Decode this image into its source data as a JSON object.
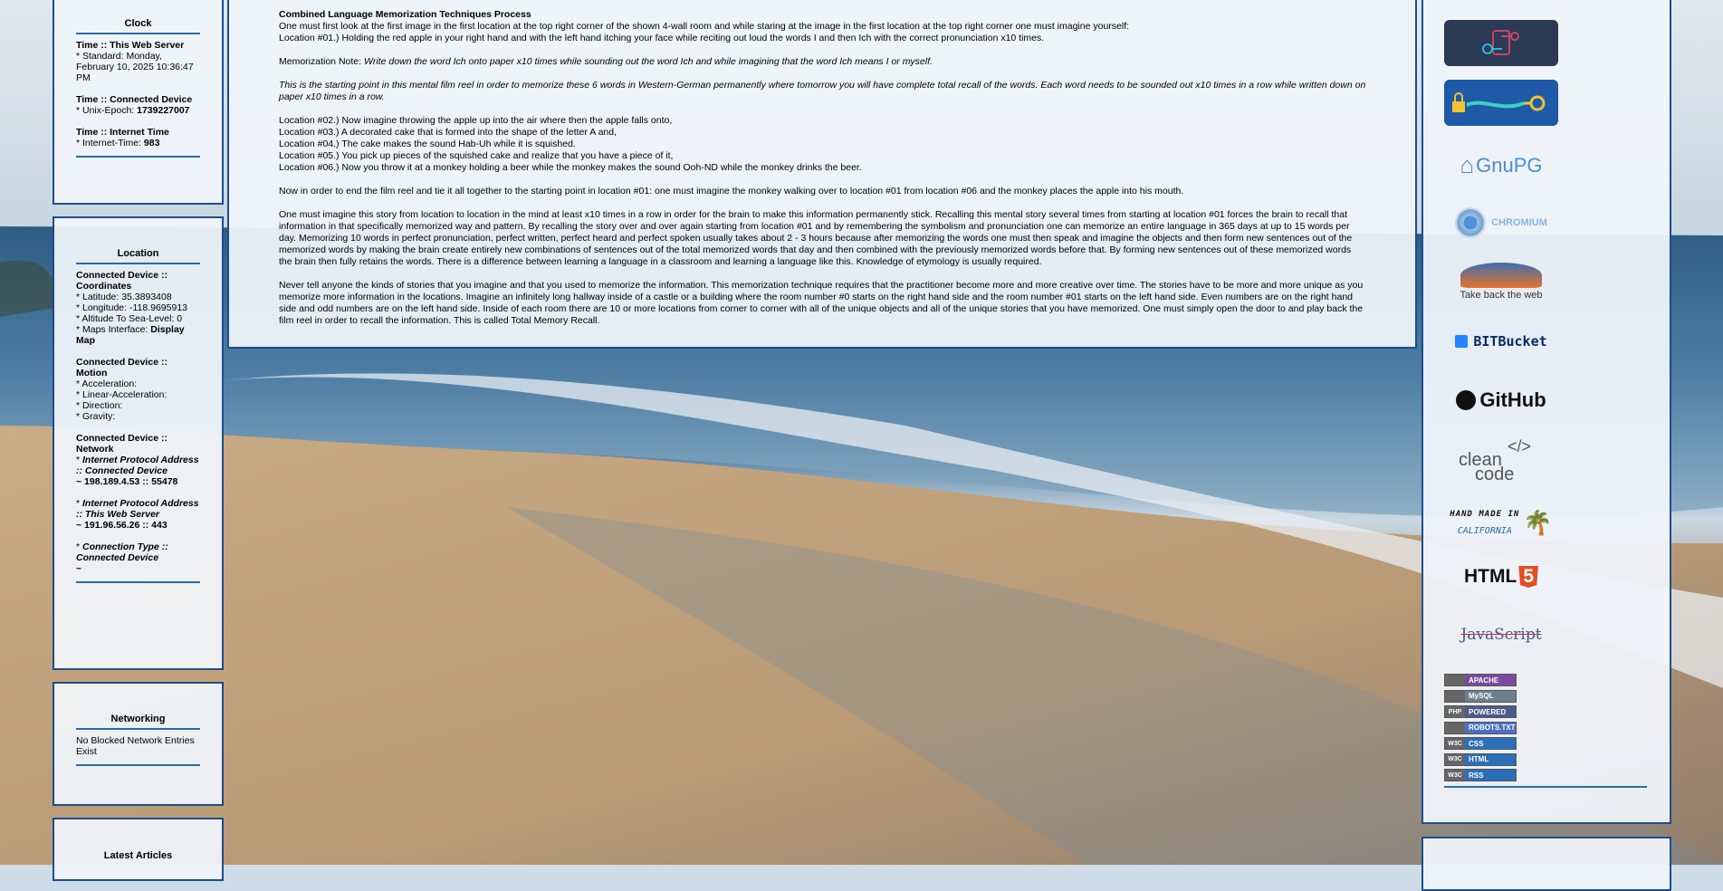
{
  "clock": {
    "title": "Clock",
    "server_heading": "Time :: This Web Server",
    "server_value": "* Standard: Monday, February 10, 2025 10:36:47 PM",
    "device_heading": "Time :: Connected Device",
    "unix_label": "* Unix-Epoch: ",
    "unix_value": "1739227007",
    "internet_heading": "Time :: Internet Time",
    "internet_label": "* Internet-Time: ",
    "internet_value": "983"
  },
  "location": {
    "title": "Location",
    "coords_heading": "Connected Device :: Coordinates",
    "latitude": "* Latitude: 35.3893408",
    "longitude": "* Longitude: -118.9695913",
    "altitude": "* Altitude To Sea-Level: 0",
    "maps_label": "* Maps Interface: ",
    "maps_link": "Display Map",
    "motion_heading": "Connected Device :: Motion",
    "acceleration": "* Acceleration:",
    "linear_acceleration": "* Linear-Acceleration:",
    "direction": "* Direction:",
    "gravity": "* Gravity:",
    "network_heading": "Connected Device :: Network",
    "ip_device_label": "Internet Protocol Address :: Connected Device",
    "ip_device_value": "~ 198.189.4.53 :: 55478",
    "ip_server_label": "Internet Protocol Address :: This Web Server",
    "ip_server_value": "~ 191.96.56.26 :: 443",
    "conn_type_label": "Connection Type :: Connected Device",
    "conn_type_value": "~"
  },
  "networking": {
    "title": "Networking",
    "text": "No Blocked Network Entries Exist"
  },
  "articles": {
    "title": "Latest Articles"
  },
  "main": {
    "heading": "Combined Language Memorization Techniques Process",
    "intro": "One must first look at the first image in the first location at the top right corner of the shown 4-wall room and while staring at the image in the first location at the top right corner one must imagine yourself:",
    "loc1": "Location #01.) Holding the red apple in your right hand and with the left hand itching your face while reciting out loud the words I and then Ich with the correct pronunciation x10 times.",
    "note_label": "Memorization Note: ",
    "note_text": "Write down the word Ich onto paper x10 times while sounding out the word Ich and while imagining that the word Ich means I or myself.",
    "starting_point": "This is the starting point in this mental film reel in order to memorize these 6 words in Western-German permanently where tomorrow you will have complete total recall of the words. Each word needs to be sounded out x10 times in a row while written down on paper x10 times in a row.",
    "loc2": "Location #02.) Now imagine throwing the apple up into the air where then the apple falls onto,",
    "loc3": "Location #03.) A decorated cake that is formed into the shape of the letter A and,",
    "loc4": "Location #04.) The cake makes the sound Hab-Uh while it is squished.",
    "loc5": "Location #05.) You pick up pieces of the squished cake and realize that you have a piece of it,",
    "loc6": "Location #06.) Now you throw it at a monkey holding a beer while the monkey makes the sound Ooh-ND while the monkey drinks the beer.",
    "end_reel": "Now in order to end the film reel and tie it all together to the starting point in location #01: one must imagine the monkey walking over to location #01 from location #06 and the monkey places the apple into his mouth.",
    "para_imagine": "One must imagine this story from location to location in the mind at least x10 times in a row in order for the brain to make this information permanently stick. Recalling this mental story several times from starting at location #01 forces the brain to recall that information in that specifically memorized way and pattern. By recalling the story over and over again starting from location #01 and by remembering the symbolism and pronunciation one can memorize an entire language in 365 days at up to 15 words per day. Memorizing 10 words in perfect pronunciation, perfect written, perfect heard and perfect spoken usually takes about 2 - 3 hours because after memorizing the words one must then speak and imagine the objects and then form new sentences out of the memorized words by making the brain create entirely new combinations of sentences out of the total memorized words that day and then combined with the previously memorized words before that. By forming new sentences out of these memorized words the brain then fully retains the words. There is a difference between learning a language in a classroom and learning a language like this. Knowledge of etymology is usually required.",
    "para_never": "Never tell anyone the kinds of stories that you imagine and that you used to memorize the information. This memorization technique requires that the practitioner become more and more creative over time. The stories have to be more and more unique as you memorize more information in the locations. Imagine an infinitely long hallway inside of a castle or a building where the room number #0 starts on the right hand side and the room number #01 starts on the left hand side. Even numbers are on the right hand side and odd numbers are on the left hand side. Inside of each room there are 10 or more locations from corner to corner with all of the unique objects and all of the unique stories that you have memorized. One must simply open the door to and play back the film reel in order to recall the information. This is called Total Memory Recall."
  },
  "sidebar_logos": {
    "gnupg": "GnuPG",
    "chromium": "CHROMIUM",
    "firefox": "Take back the web",
    "bitbucket": "BITBucket",
    "github": "GitHub",
    "cleancode_1": "clean",
    "cleancode_2": "code",
    "cleancode_tag": "</>",
    "handmade_1": "HAND MADE IN",
    "handmade_2": "CALIFORNIA",
    "html5": "HTML",
    "html5_num": "5",
    "javascript": "JavaScript"
  },
  "badges": [
    {
      "left": "",
      "right": "APACHE"
    },
    {
      "left": "",
      "right": "MySQL"
    },
    {
      "left": "PHP",
      "right": "POWERED"
    },
    {
      "left": "",
      "right": "ROBOTS.TXT"
    },
    {
      "left": "W3C",
      "right": "CSS"
    },
    {
      "left": "W3C",
      "right": "HTML"
    },
    {
      "left": "W3C",
      "right": "RSS"
    }
  ],
  "colors": {
    "panel_border": "#1d4d8c",
    "rule": "#2a6aa5",
    "logo_dark_bg": "#2b3a55",
    "logo_blue_bg": "#1e5aa8",
    "html5_orange": "#e44d26",
    "bitbucket_blue": "#2684ff"
  }
}
